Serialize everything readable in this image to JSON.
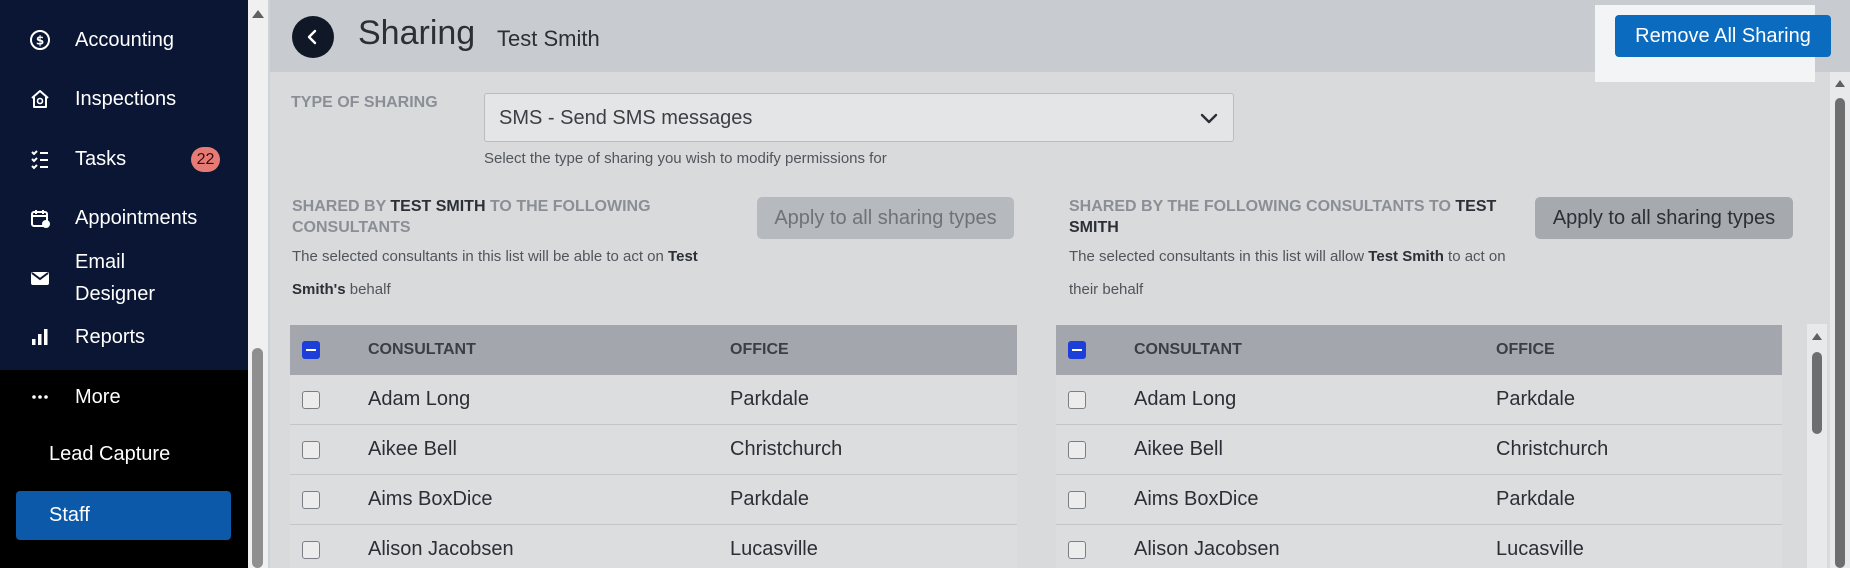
{
  "sidebar": {
    "items": [
      {
        "label": "Accounting",
        "icon": "dollar-circle-icon"
      },
      {
        "label": "Inspections",
        "icon": "house-search-icon"
      },
      {
        "label": "Tasks",
        "icon": "checklist-icon",
        "badge": "22"
      },
      {
        "label": "Appointments",
        "icon": "calendar-icon"
      },
      {
        "label": "Email Designer",
        "icon": "envelope-icon"
      },
      {
        "label": "Reports",
        "icon": "bar-chart-icon"
      },
      {
        "label": "More",
        "icon": "ellipsis-icon"
      }
    ],
    "sub_items": [
      {
        "label": "Lead Capture"
      },
      {
        "label": "Staff",
        "active": true
      }
    ],
    "colors": {
      "background": "#0a1633",
      "active": "#0b59a8",
      "badge": "#e57b74"
    }
  },
  "header": {
    "title": "Sharing",
    "subtitle": "Test Smith",
    "remove_all_label": "Remove All Sharing",
    "accent": "#0b6cbf"
  },
  "type_of_sharing": {
    "label": "TYPE OF SHARING",
    "selected": "SMS - Send SMS messages",
    "help": "Select the type of sharing you wish to modify permissions for"
  },
  "left_section": {
    "title_pre": "SHARED BY ",
    "title_name": "TEST SMITH",
    "title_post": " TO THE FOLLOWING CONSULTANTS",
    "desc_pre": "The selected consultants in this list will be able to act on ",
    "desc_name": "Test Smith's",
    "desc_post": " behalf",
    "apply_label": "Apply to all sharing types"
  },
  "right_section": {
    "title_pre": "SHARED BY THE FOLLOWING CONSULTANTS TO ",
    "title_name": "TEST SMITH",
    "desc_pre": "The selected consultants in this list will allow ",
    "desc_name": "Test Smith",
    "desc_post": " to act on their behalf",
    "apply_label": "Apply to all sharing types"
  },
  "table": {
    "columns": [
      "CONSULTANT",
      "OFFICE"
    ],
    "rows": [
      {
        "consultant": "Adam Long",
        "office": "Parkdale"
      },
      {
        "consultant": "Aikee Bell",
        "office": "Christchurch"
      },
      {
        "consultant": "Aims BoxDice",
        "office": "Parkdale"
      },
      {
        "consultant": "Alison Jacobsen",
        "office": "Lucasville"
      }
    ]
  }
}
